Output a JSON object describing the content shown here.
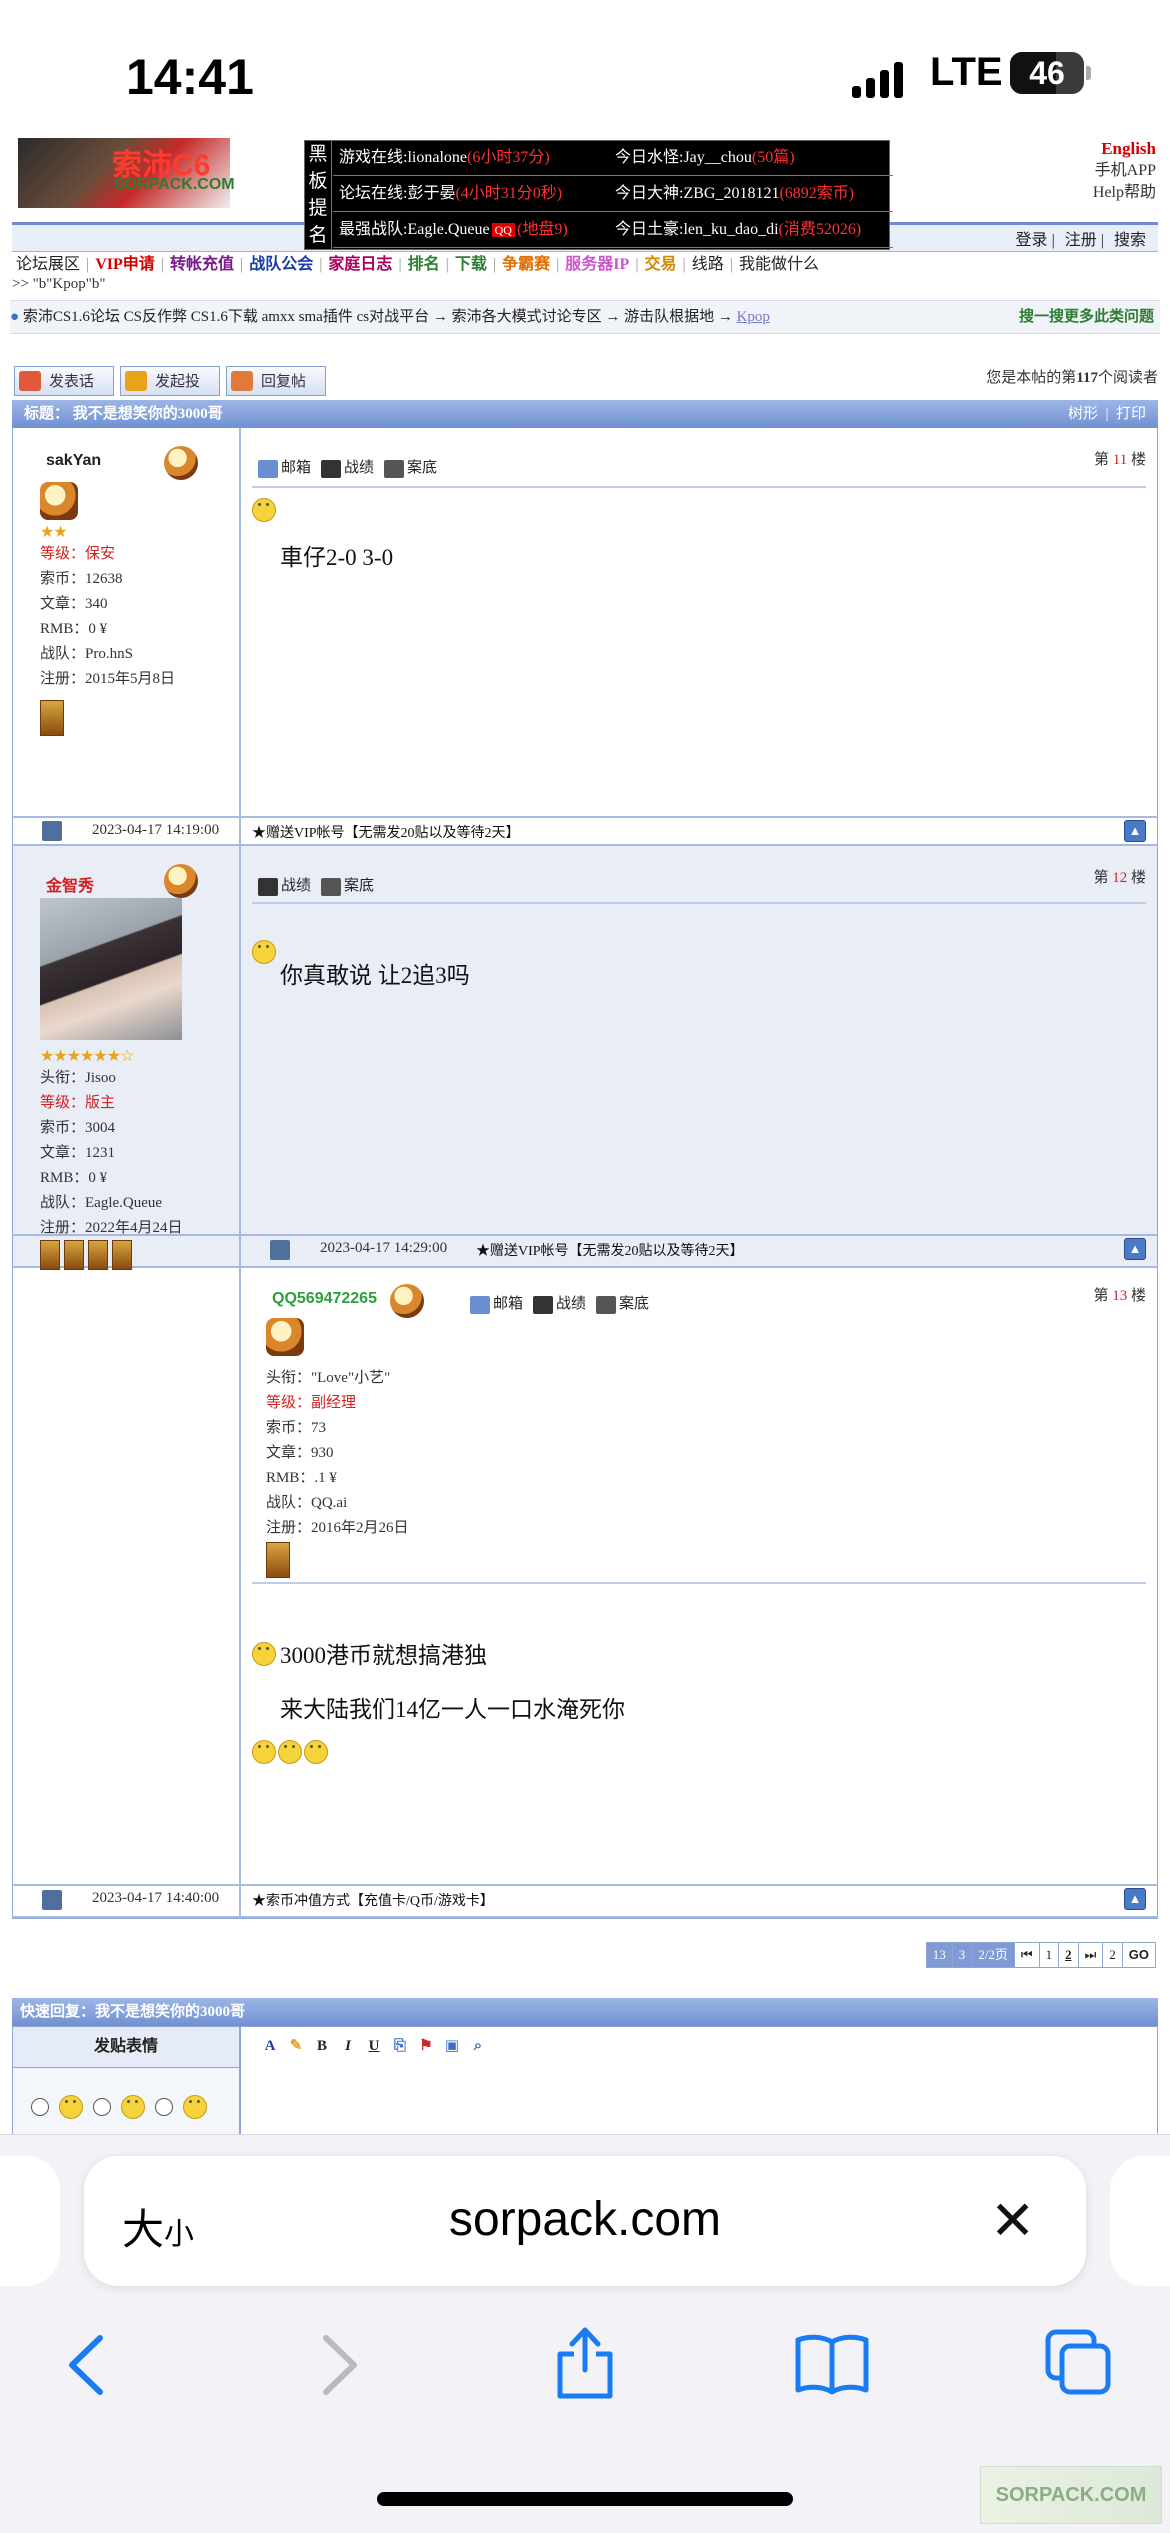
{
  "status_bar": {
    "time": "14:41",
    "network": "LTE",
    "battery": "46"
  },
  "header": {
    "logo_text": "索沛C6",
    "logo_sub": "SORPACK.COM",
    "blackboard_label": "黑板提名",
    "stats": [
      {
        "label": "游戏在线:",
        "name": "lionalone",
        "extra": "(6小时37分)"
      },
      {
        "label": "今日水怪:",
        "name": "Jay__chou",
        "extra": "(50篇)"
      },
      {
        "label": "论坛在线:",
        "name": "彭于晏",
        "extra": "(4小时31分0秒)"
      },
      {
        "label": "今日大神:",
        "name": "ZBG_2018121",
        "extra": "(6892索币)"
      },
      {
        "label": "最强战队:",
        "name": "Eagle.Queue",
        "badge": "QQ",
        "extra": "(地盘9)"
      },
      {
        "label": "今日土豪:",
        "name": "len_ku_dao_di",
        "extra": "(消费52026)"
      }
    ],
    "right_links": [
      "English",
      "手机APP",
      "Help帮助"
    ],
    "login_links": [
      "登录",
      "注册",
      "搜索"
    ]
  },
  "nav": [
    {
      "label": "论坛展区",
      "color": "#222222"
    },
    {
      "label": "VIP申请",
      "color": "#d40000"
    },
    {
      "label": "转帐充值",
      "color": "#7a1a8a"
    },
    {
      "label": "战队公会",
      "color": "#1a3aa8"
    },
    {
      "label": "家庭日志",
      "color": "#a8005a"
    },
    {
      "label": "排名",
      "color": "#2e7d32"
    },
    {
      "label": "下载",
      "color": "#2e7d32"
    },
    {
      "label": "争霸赛",
      "color": "#e07000"
    },
    {
      "label": "服务器IP",
      "color": "#cc55cc"
    },
    {
      "label": "交易",
      "color": "#d08a00"
    },
    {
      "label": "线路",
      "color": "#222222"
    },
    {
      "label": "我能做什么",
      "color": "#222222"
    }
  ],
  "crumb_small": ">> \"b\"Kpop\"b\"",
  "breadcrumb": {
    "text": "索沛CS1.6论坛 CS反作弊 CS1.6下载 amxx sma插件 cs对战平台 → 索沛各大模式讨论专区 → 游击队根据地 →",
    "link": "Kpop",
    "right": "搜一搜更多此类问题"
  },
  "actions": [
    "发表话题",
    "发起投票",
    "回复帖子"
  ],
  "reader_text": {
    "pre": "您是本帖的第",
    "num": "117",
    "post": "个阅读者"
  },
  "thread": {
    "title_label": "标题：",
    "title": "我不是想笑你的3000哥",
    "view_links": [
      "树形",
      "打印"
    ]
  },
  "posts": [
    {
      "username": "sakYan",
      "user_color": "#2e7d32",
      "stars": "★★",
      "info": [
        {
          "k": "等级：",
          "v": "保安",
          "red": true
        },
        {
          "k": "索币：",
          "v": "12638"
        },
        {
          "k": "文章：",
          "v": "340"
        },
        {
          "k": "RMB：",
          "v": "0 ¥"
        },
        {
          "k": "战队：",
          "v": "Pro.hnS"
        },
        {
          "k": "注册：",
          "v": "2015年5月8日"
        }
      ],
      "tools": [
        "邮箱",
        "战绩",
        "案底"
      ],
      "floor_pre": "第",
      "floor_num": "11",
      "floor_post": "楼",
      "messages": [
        "車仔2-0 3-0"
      ],
      "date": "2023-04-17 14:19:00",
      "footer": "★赠送VIP帐号【无需发20贴以及等待2天】"
    },
    {
      "username": "金智秀",
      "user_color": "#d42020",
      "stars": "★★★★★★☆",
      "info": [
        {
          "k": "头衔：",
          "v": "Jisoo"
        },
        {
          "k": "等级：",
          "v": "版主",
          "red": true
        },
        {
          "k": "索币：",
          "v": "3004"
        },
        {
          "k": "文章：",
          "v": "1231"
        },
        {
          "k": "RMB：",
          "v": "0 ¥"
        },
        {
          "k": "战队：",
          "v": "Eagle.Queue"
        },
        {
          "k": "注册：",
          "v": "2022年4月24日"
        }
      ],
      "tools": [
        "战绩",
        "案底"
      ],
      "floor_pre": "第",
      "floor_num": "12",
      "floor_post": "楼",
      "messages": [
        "你真敢说 让2追3吗"
      ],
      "date": "2023-04-17 14:29:00",
      "footer": "★赠送VIP帐号【无需发20贴以及等待2天】"
    },
    {
      "username": "QQ569472265",
      "user_color": "#2e9e3e",
      "info": [
        {
          "k": "头衔：",
          "v": "\"Love\"小艺\""
        },
        {
          "k": "等级：",
          "v": "副经理",
          "red": true
        },
        {
          "k": "索币：",
          "v": "73"
        },
        {
          "k": "文章：",
          "v": "930"
        },
        {
          "k": "RMB：",
          "v": ".1 ¥"
        },
        {
          "k": "战队：",
          "v": "QQ.ai"
        },
        {
          "k": "注册：",
          "v": "2016年2月26日"
        }
      ],
      "tools": [
        "邮箱",
        "战绩",
        "案底"
      ],
      "floor_pre": "第",
      "floor_num": "13",
      "floor_post": "楼",
      "messages": [
        "3000港币就想搞港独",
        "来大陆我们14亿一人一口水淹死你"
      ],
      "date": "2023-04-17 14:40:00",
      "footer": "★索币冲值方式【充值卡/Q币/游戏卡】"
    }
  ],
  "pagination": [
    "13",
    "3",
    "2/2页",
    "⏮",
    "1",
    "2",
    "⏭",
    "2",
    "GO"
  ],
  "quick_reply": {
    "title": "快速回复：我不是想笑你的3000哥",
    "emote_label": "发贴表情"
  },
  "safari": {
    "aa": "大",
    "aa_small": "小",
    "url": "sorpack.com"
  },
  "watermark": "SORPACK.COM"
}
